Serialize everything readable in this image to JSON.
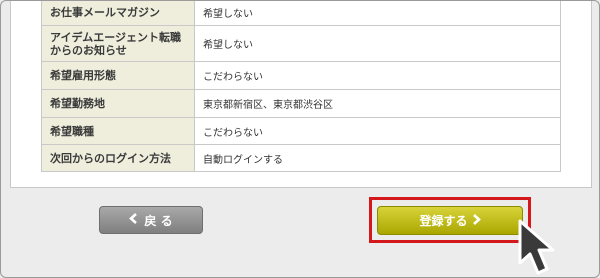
{
  "table": {
    "rows": [
      {
        "label": "お仕事メールマガジン",
        "value": "希望しない"
      },
      {
        "label": "アイデムエージェント転職からのお知らせ",
        "value": "希望しない"
      },
      {
        "label": "希望雇用形態",
        "value": "こだわらない"
      },
      {
        "label": "希望勤務地",
        "value": "東京都新宿区、東京都渋谷区"
      },
      {
        "label": "希望職種",
        "value": "こだわらない"
      },
      {
        "label": "次回からのログイン方法",
        "value": "自動ログインする"
      }
    ]
  },
  "buttons": {
    "back_label": "戻 る",
    "back_icon": "chevron-left-icon",
    "register_label": "登録する",
    "register_icon": "chevron-right-icon"
  },
  "colors": {
    "label_bg": "#efeedd",
    "register_button": "#c2be18",
    "back_button": "#959595",
    "highlight": "#d4181b"
  }
}
